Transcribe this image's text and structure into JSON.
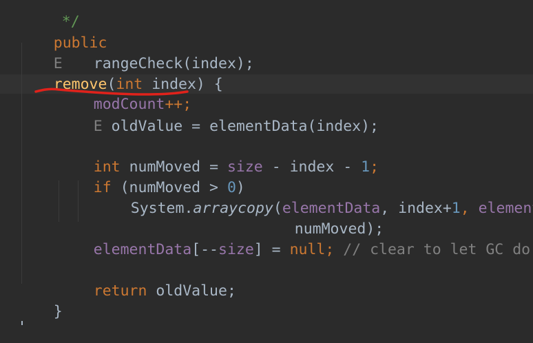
{
  "code": {
    "line_0": "*/",
    "line_1": {
      "public": "public",
      "E": "E",
      "remove": "remove",
      "paren_open": "(",
      "int": "int",
      "index": " index) {"
    },
    "line_2": "rangeCheck(index);",
    "line_4": {
      "modCount": "modCount",
      "rest": "++;"
    },
    "line_5": {
      "E": "E",
      "rest": " oldValue = elementData(index);"
    },
    "line_7": {
      "int": "int",
      "a": " numMoved = ",
      "size": "size",
      "b": " - index - ",
      "one": "1",
      "semi": ";"
    },
    "line_8": {
      "if": "if",
      "a": " (numMoved > ",
      "zero": "0",
      "b": ")"
    },
    "line_9": {
      "a": "System.",
      "arraycopy": "arraycopy",
      "b": "(",
      "elementData": "elementData",
      "c": ", index+",
      "one": "1",
      "d": ", ",
      "elementData2": "element"
    },
    "line_10": "numMoved);",
    "line_11": {
      "elementData": "elementData",
      "a": "[--",
      "size": "size",
      "b": "] = ",
      "null": "null",
      "semi": ";",
      "comment": " // clear to let GC do"
    },
    "line_13": {
      "return": "return",
      "rest": " oldValue;"
    },
    "line_14": "}"
  },
  "colors": {
    "background": "#2b2b2b",
    "keyword": "#cc7832",
    "method": "#ffc66d",
    "field": "#9876aa",
    "number": "#6897bb",
    "comment": "#808080",
    "annotation": "#e0221b"
  }
}
